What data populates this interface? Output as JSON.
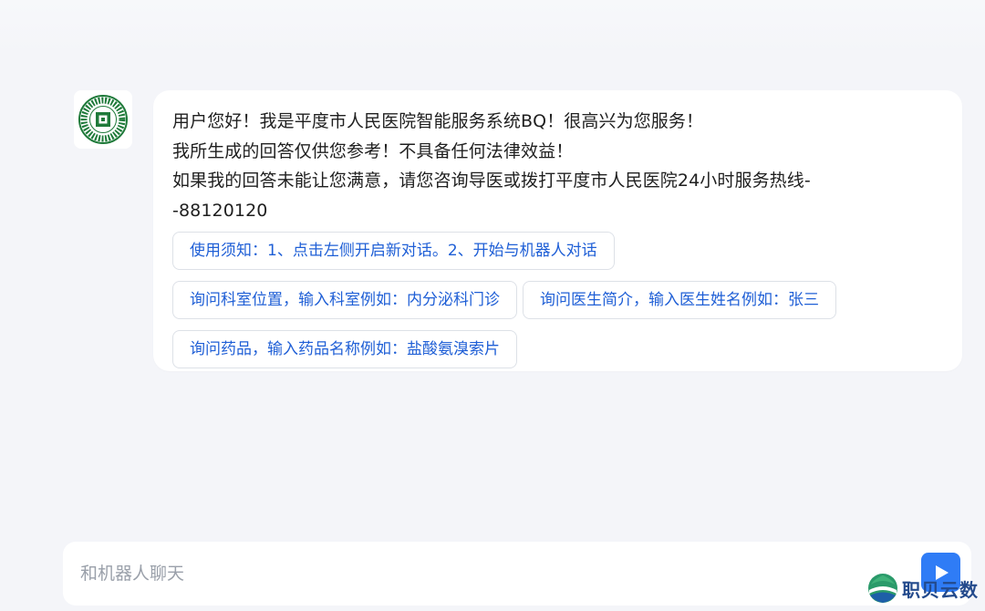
{
  "bot_message": {
    "lines": [
      "用户您好！我是平度市人民医院智能服务系统BQ！很高兴为您服务！",
      "我所生成的回答仅供您参考！不具备任何法律效益！",
      "如果我的回答未能让您满意，请您咨询导医或拨打平度市人民医院24小时服务热线-",
      "-88120120"
    ],
    "suggestions": [
      "使用须知：1、点击左侧开启新对话。2、开始与机器人对话",
      "询问科室位置，输入科室例如：内分泌科门诊",
      "询问医生简介，输入医生姓名例如：张三",
      "询问药品，输入药品名称例如：盐酸氨溴索片"
    ]
  },
  "composer": {
    "placeholder": "和机器人聊天"
  },
  "watermark": {
    "text": "职贝云数"
  },
  "colors": {
    "accent": "#2f7cf6",
    "chip_text": "#1f5fd6",
    "logo_green": "#1f7a3a"
  },
  "icons": {
    "avatar": "hospital-logo-icon",
    "send": "send-icon",
    "watermark": "globe-logo-icon"
  }
}
